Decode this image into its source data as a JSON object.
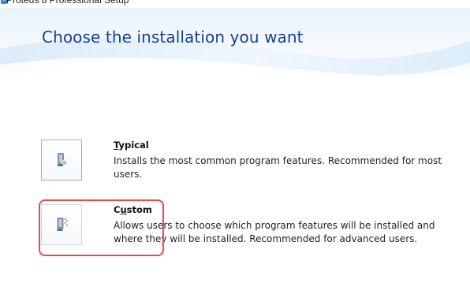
{
  "window": {
    "title": "Proteus 8 Professional Setup"
  },
  "header": {
    "title": "Choose the installation you want"
  },
  "options": [
    {
      "label_prefix": "",
      "label_mnemonic": "T",
      "label_rest": "ypical",
      "description": "Installs the most common program features. Recommended for most users.",
      "icon": "installer-icon"
    },
    {
      "label_prefix": "C",
      "label_mnemonic": "u",
      "label_rest": "stom",
      "description": "Allows users to choose which program features will be installed and where they will be installed. Recommended for advanced users.",
      "icon": "custom-installer-icon"
    }
  ],
  "colors": {
    "title_blue": "#153f96",
    "highlight_red": "#e24d4d",
    "header_tint": "#dcebf8"
  }
}
